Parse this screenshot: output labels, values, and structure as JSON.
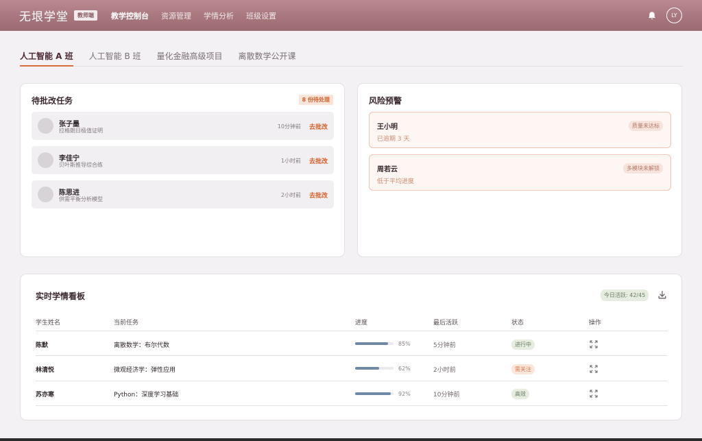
{
  "header": {
    "logo": "无垠学堂",
    "role_badge": "教师端",
    "nav": [
      "教学控制台",
      "资源管理",
      "学情分析",
      "班级设置"
    ],
    "avatar_initials": "LY"
  },
  "tabs": [
    "人工智能 A 班",
    "人工智能 B 班",
    "量化金融高级项目",
    "离散数学公开课"
  ],
  "pending": {
    "title": "待批改任务",
    "badge": "8 份待处理",
    "items": [
      {
        "name": "张子墨",
        "task": "拉格朗日极值证明",
        "time": "10分钟前",
        "action": "去批改"
      },
      {
        "name": "李佳宁",
        "task": "贝叶斯推导综合练",
        "time": "1小时前",
        "action": "去批改"
      },
      {
        "name": "陈思进",
        "task": "供需平衡分析模型",
        "time": "2小时前",
        "action": "去批改"
      }
    ]
  },
  "risk": {
    "title": "风险预警",
    "items": [
      {
        "name": "王小明",
        "desc": "已逾期 3 天",
        "tag": "质量未达标"
      },
      {
        "name": "周若云",
        "desc": "低于平均进度",
        "tag": "多模块未解锁"
      }
    ]
  },
  "board": {
    "title": "实时学情看板",
    "active_badge": "今日活跃: 42/45",
    "headers": [
      "学生姓名",
      "当前任务",
      "进度",
      "最后活跃",
      "状态",
      "操作"
    ],
    "rows": [
      {
        "name": "陈默",
        "task": "离散数学：布尔代数",
        "progress": 85,
        "progress_label": "85%",
        "last": "5分钟前",
        "status": "进行中",
        "status_color": "#6a7d66",
        "status_bg": "#e6ecdf"
      },
      {
        "name": "林清悦",
        "task": "微观经济学：弹性应用",
        "progress": 62,
        "progress_label": "62%",
        "last": "2小时前",
        "status": "需关注",
        "status_color": "#d9774d",
        "status_bg": "#fbe6dc"
      },
      {
        "name": "苏亦寒",
        "task": "Python：深度学习基础",
        "progress": 92,
        "progress_label": "92%",
        "last": "10分钟前",
        "status": "高效",
        "status_color": "#6a7d66",
        "status_bg": "#e6ecdf"
      }
    ]
  },
  "colors": {
    "accent": "#d9602c",
    "header": "#a8777d",
    "progress": "#6e8aa6"
  }
}
